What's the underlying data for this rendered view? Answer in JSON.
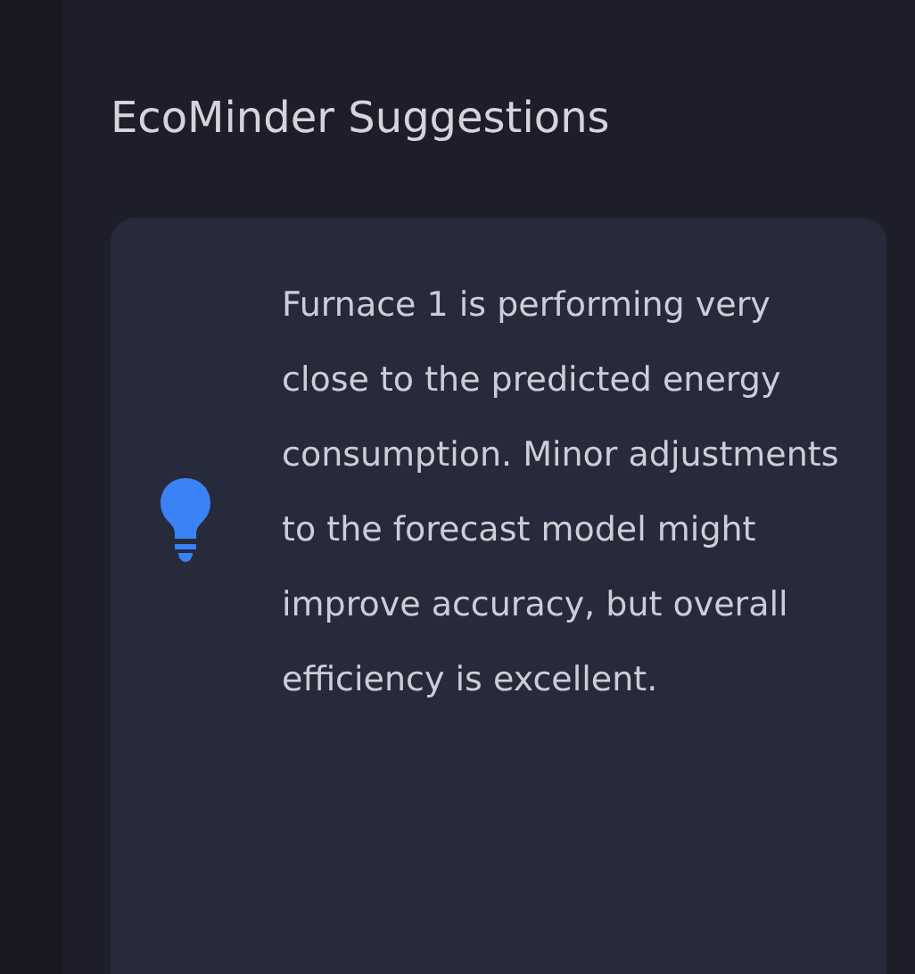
{
  "panel": {
    "title": "EcoMinder Suggestions"
  },
  "suggestion": {
    "text": "Furnace 1 is performing very close to the predicted energy consumption. Minor adjustments to the forecast model might improve accuracy, but overall efficiency is excellent."
  }
}
